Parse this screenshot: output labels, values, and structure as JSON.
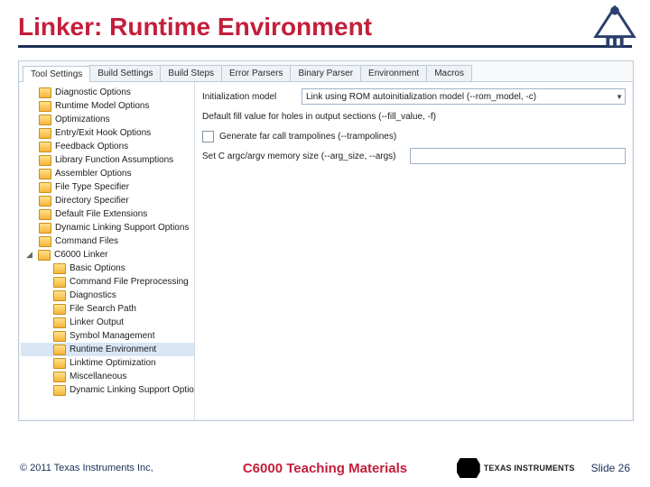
{
  "title": "Linker: Runtime Environment",
  "tabs": [
    "Tool Settings",
    "Build Settings",
    "Build Steps",
    "Error Parsers",
    "Binary Parser",
    "Environment",
    "Macros"
  ],
  "active_tab": 0,
  "tree_top": [
    "Diagnostic Options",
    "Runtime Model Options",
    "Optimizations",
    "Entry/Exit Hook Options",
    "Feedback Options",
    "Library Function Assumptions",
    "Assembler Options",
    "File Type Specifier",
    "Directory Specifier",
    "Default File Extensions",
    "Dynamic Linking Support Options",
    "Command Files"
  ],
  "tree_linker_label": "C6000 Linker",
  "tree_linker": [
    "Basic Options",
    "Command File Preprocessing",
    "Diagnostics",
    "File Search Path",
    "Linker Output",
    "Symbol Management",
    "Runtime Environment",
    "Linktime Optimization",
    "Miscellaneous",
    "Dynamic Linking Support Options"
  ],
  "tree_selected_index": 6,
  "form": {
    "init_label": "Initialization model",
    "init_value": "Link using ROM autoinitialization model (--rom_model, -c)",
    "fill_label": "Default fill value for holes in output sections (--fill_value, -f)",
    "tramp_label": "Generate far call trampolines (--trampolines)",
    "arg_label": "Set C argc/argv memory size (--arg_size, --args)"
  },
  "footer": {
    "copyright": "© 2011 Texas Instruments Inc,",
    "center": "C6000 Teaching Materials",
    "ti_text": "TEXAS INSTRUMENTS",
    "slide": "Slide 26"
  }
}
